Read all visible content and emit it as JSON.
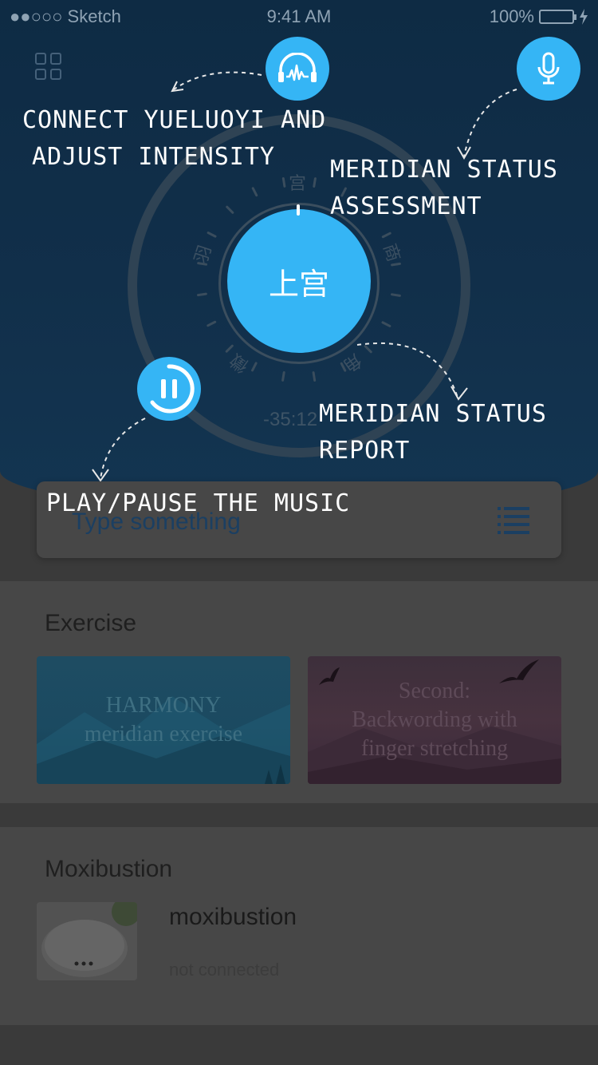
{
  "status_bar": {
    "carrier": "●●○○○ Sketch",
    "time": "9:41 AM",
    "battery": "100%"
  },
  "header": {
    "dial_label": "上宫",
    "dial_notes": [
      "宫",
      "商",
      "角",
      "徵",
      "羽"
    ],
    "timer": "-35:12"
  },
  "annotations": {
    "connect": [
      "Connect Yueluoyi and",
      "adjust intensity"
    ],
    "assessment": [
      "Meridian status",
      "assessment"
    ],
    "report": [
      "Meridian status",
      "report"
    ],
    "play": "Play/pause the music"
  },
  "search": {
    "placeholder": "Type something"
  },
  "exercise": {
    "title": "Exercise",
    "cards": [
      {
        "line1": "HARMONY",
        "line2": "meridian exercise"
      },
      {
        "line1": "Second:",
        "line2": "Backwording with",
        "line3": "finger stretching"
      }
    ]
  },
  "moxibustion": {
    "title": "Moxibustion",
    "device_name": "moxibustion",
    "device_status": "not connected"
  },
  "icons": {
    "menu": "grid-icon",
    "headphone": "headphone-wave-icon",
    "mic": "microphone-icon",
    "play": "pause-icon",
    "list": "list-icon"
  },
  "colors": {
    "accent": "#35b5f5",
    "header_bg": "#112f4a"
  }
}
